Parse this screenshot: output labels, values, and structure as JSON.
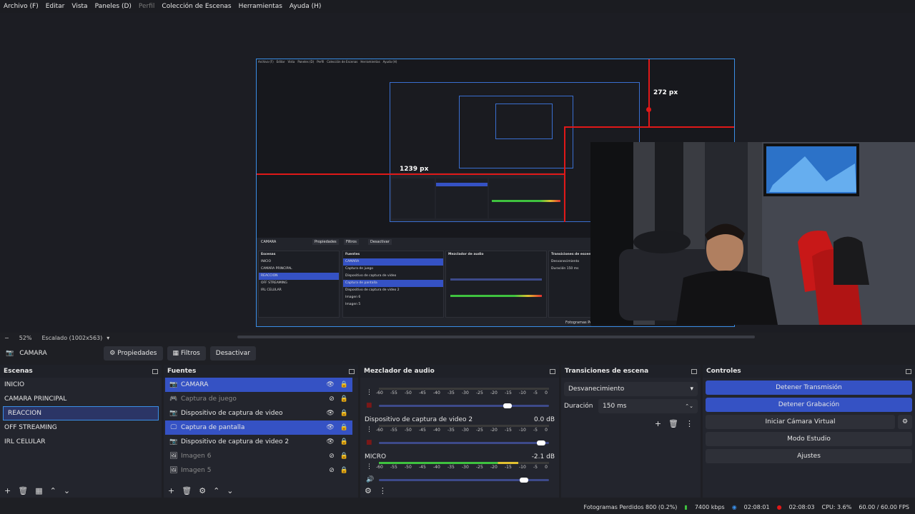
{
  "menu": [
    "Archivo (F)",
    "Editar",
    "Vista",
    "Paneles (D)",
    "Perfil",
    "Colección de Escenas",
    "Herramientas",
    "Ayuda (H)"
  ],
  "menu_disabled_index": 4,
  "preview": {
    "measure_top": "272 px",
    "measure_left": "1239 px",
    "nested_measure_top": "272 px",
    "nested_measure_left": "1239 px",
    "bottom_text": "Fotogramas Per",
    "mini_scene": "CAMARA",
    "mini_props": "Propiedades",
    "mini_filters": "Filtros",
    "mini_deactivate": "Desactivar",
    "mini_scenes_title": "Escenas",
    "mini_sources_title": "Fuentes",
    "mini_mixer_title": "Mezclador de audio",
    "mini_transitions_title": "Transiciones de escena",
    "mini_transition": "Desvanecimiento",
    "mini_duration_label": "Duración",
    "mini_duration": "150 ms"
  },
  "status_line": {
    "zoom": "52%",
    "scaling": "Escalado (1002x563)"
  },
  "scene_bar": {
    "current_scene": "CAMARA",
    "properties": "Propiedades",
    "filters": "Filtros",
    "deactivate": "Desactivar"
  },
  "scenes": {
    "title": "Escenas",
    "items": [
      "INICIO",
      "CAMARA PRINCIPAL",
      "REACCION",
      "OFF STREAMING",
      "IRL CELULAR"
    ],
    "selected_index": 2
  },
  "sources": {
    "title": "Fuentes",
    "items": [
      {
        "label": "CAMARA",
        "icon": "camera-icon",
        "visible": true,
        "selected": true
      },
      {
        "label": "Captura de juego",
        "icon": "gamepad-icon",
        "visible": false,
        "selected": false
      },
      {
        "label": "Dispositivo de captura de video",
        "icon": "camera-icon",
        "visible": true,
        "selected": false
      },
      {
        "label": "Captura de pantalla",
        "icon": "monitor-icon",
        "visible": true,
        "selected": true
      },
      {
        "label": "Dispositivo de captura de video 2",
        "icon": "camera-icon",
        "visible": true,
        "selected": false
      },
      {
        "label": "Imagen 6",
        "icon": "image-icon",
        "visible": false,
        "selected": false
      },
      {
        "label": "Imagen 5",
        "icon": "image-icon",
        "visible": false,
        "selected": false
      }
    ]
  },
  "mixer": {
    "title": "Mezclador de audio",
    "ticks": [
      "-60",
      "-55",
      "-50",
      "-45",
      "-40",
      "-35",
      "-30",
      "-25",
      "-20",
      "-15",
      "-10",
      "-5",
      "0"
    ],
    "channels": [
      {
        "name": "",
        "db": "",
        "level": 0.0,
        "fader": 0.78
      },
      {
        "name": "Dispositivo de captura de video 2",
        "db": "0.0 dB",
        "level": 0.0,
        "fader": 0.98
      },
      {
        "name": "MICRO",
        "db": "-2.1 dB",
        "level": 0.82,
        "fader": 0.88
      }
    ]
  },
  "transitions": {
    "title": "Transiciones de escena",
    "selected": "Desvanecimiento",
    "duration_label": "Duración",
    "duration": "150 ms"
  },
  "controls": {
    "title": "Controles",
    "buttons": [
      {
        "label": "Detener Transmisión",
        "active": true
      },
      {
        "label": "Detener Grabación",
        "active": true
      },
      {
        "label": "Iniciar Cámara Virtual",
        "active": false
      },
      {
        "label": "Modo Estudio",
        "active": false
      },
      {
        "label": "Ajustes",
        "active": false
      }
    ]
  },
  "statusbar": {
    "dropped_frames": "Fotogramas Perdidos 800 (0.2%)",
    "bitrate": "7400 kbps",
    "stream_time": "02:08:01",
    "rec_time": "02:08:03",
    "cpu": "CPU: 3.6%",
    "fps": "60.00 / 60.00 FPS"
  },
  "colors": {
    "accent": "#3552c4",
    "measure_red": "#e01818",
    "preview_border": "#3a8ee6"
  }
}
